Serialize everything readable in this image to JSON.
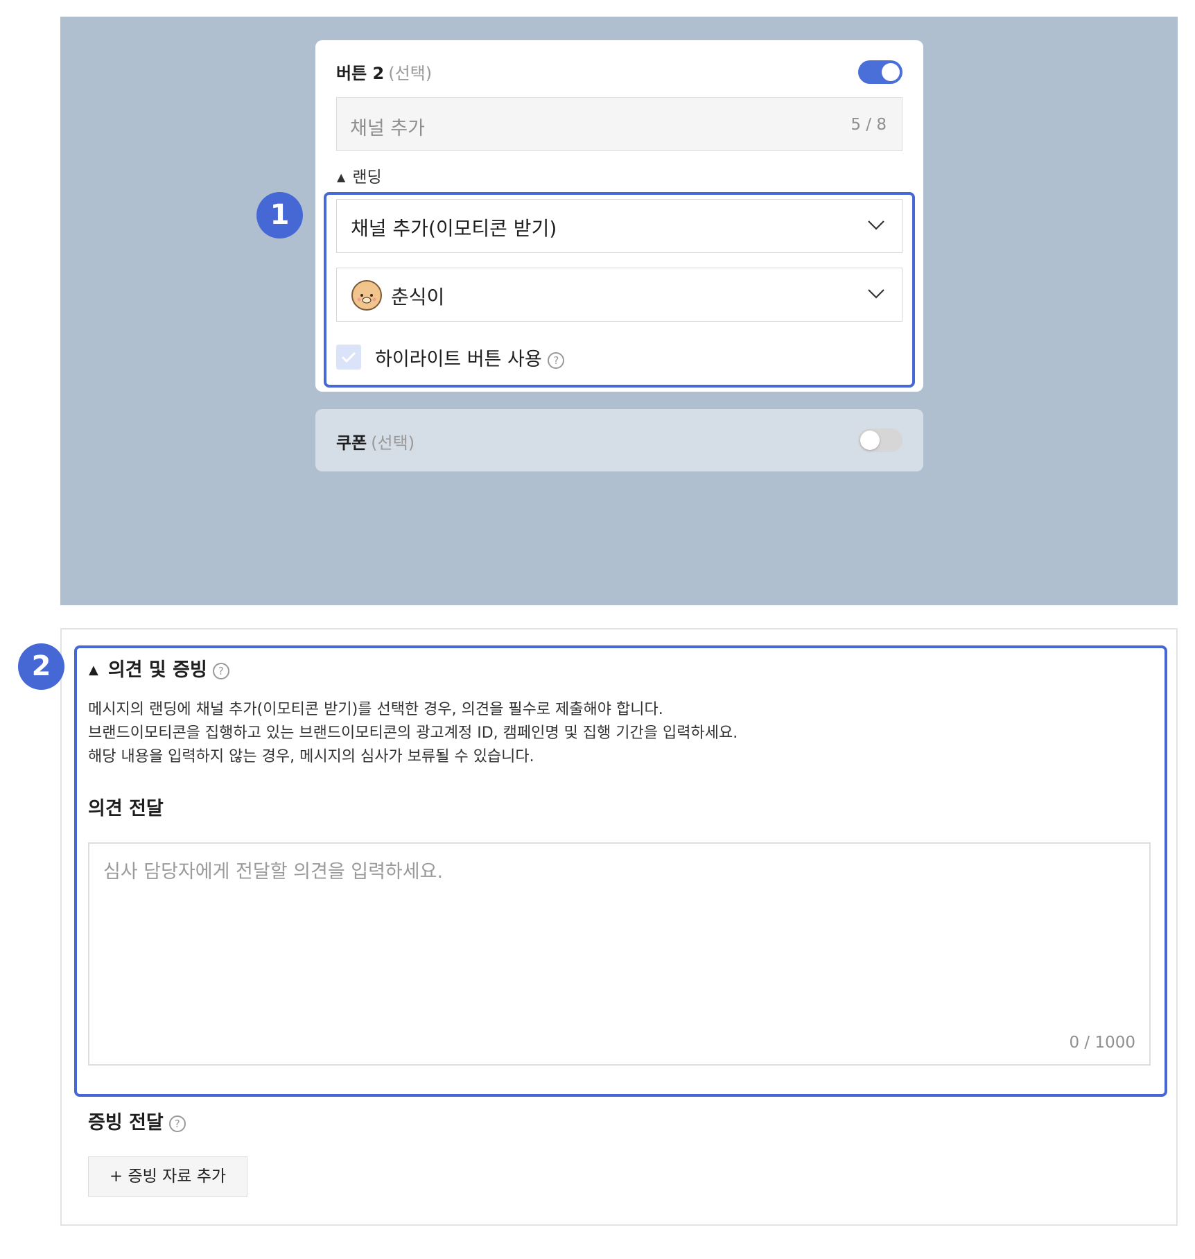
{
  "preview": {
    "button2": {
      "title": "버튼 2",
      "optional": "(선택)",
      "enabled": true,
      "name_value": "채널 추가",
      "name_count": "5 / 8",
      "landing_label": "랜딩",
      "landing_select": "채널 추가(이모티콘 받기)",
      "emoticon_select": "춘식이",
      "highlight_label": "하이라이트 버튼 사용",
      "highlight_checked": true
    },
    "coupon": {
      "title": "쿠폰",
      "optional": "(선택)",
      "enabled": false
    },
    "badges": [
      "1",
      "2"
    ]
  },
  "opinion_section": {
    "title": "의견 및 증빙",
    "description_lines": [
      "메시지의 랜딩에 채널 추가(이모티콘 받기)를 선택한 경우, 의견을 필수로 제출해야 합니다.",
      "브랜드이모티콘을 집행하고 있는 브랜드이모티콘의 광고계정 ID, 캠페인명 및 집행 기간을 입력하세요.",
      "해당 내용을 입력하지 않는 경우, 메시지의 심사가 보류될 수 있습니다."
    ],
    "opinion_label": "의견 전달",
    "opinion_placeholder": "심사 담당자에게 전달할 의견을 입력하세요.",
    "opinion_count": "0 / 1000",
    "evidence_label": "증빙 전달",
    "add_evidence_button": "+ 증빙 자료 추가"
  },
  "colors": {
    "accent": "#4568d4",
    "preview_bg": "#b0bfcf",
    "coupon_bg": "#d5dde6"
  },
  "icons": [
    "toggle-switch",
    "triangle-up-icon",
    "chevron-down-icon",
    "character-avatar-icon",
    "checkbox-check-icon",
    "help-circle-icon"
  ]
}
